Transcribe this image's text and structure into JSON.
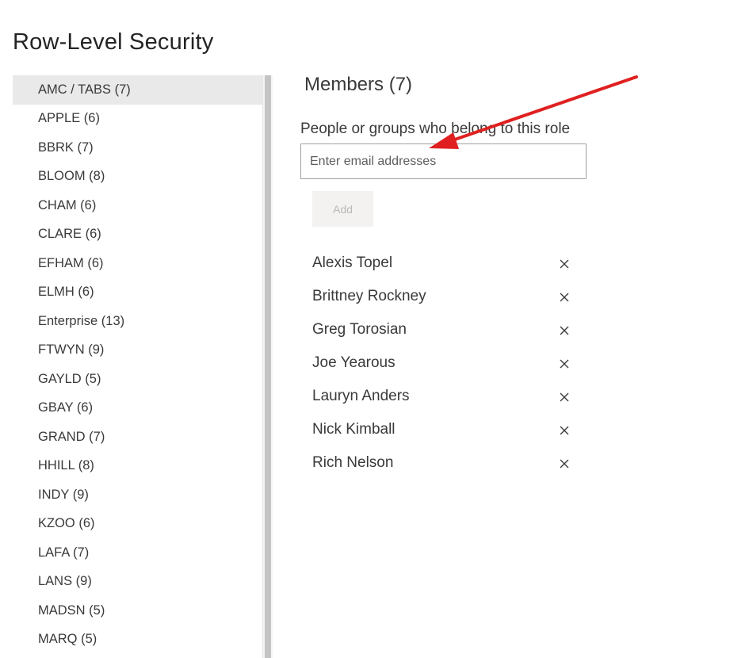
{
  "page": {
    "title": "Row-Level Security"
  },
  "roles": [
    {
      "label": "AMC / TABS (7)",
      "selected": true
    },
    {
      "label": "APPLE (6)"
    },
    {
      "label": "BBRK (7)"
    },
    {
      "label": "BLOOM (8)"
    },
    {
      "label": "CHAM (6)"
    },
    {
      "label": "CLARE (6)"
    },
    {
      "label": "EFHAM (6)"
    },
    {
      "label": "ELMH (6)"
    },
    {
      "label": "Enterprise (13)"
    },
    {
      "label": "FTWYN (9)"
    },
    {
      "label": "GAYLD (5)"
    },
    {
      "label": "GBAY (6)"
    },
    {
      "label": "GRAND (7)"
    },
    {
      "label": "HHILL (8)"
    },
    {
      "label": "INDY (9)"
    },
    {
      "label": "KZOO (6)"
    },
    {
      "label": "LAFA (7)"
    },
    {
      "label": "LANS (9)"
    },
    {
      "label": "MADSN (5)"
    },
    {
      "label": "MARQ (5)"
    }
  ],
  "members_panel": {
    "heading": "Members (7)",
    "field_label": "People or groups who belong to this role",
    "email_input": {
      "value": "",
      "placeholder": "Enter email addresses"
    },
    "add_button_label": "Add",
    "members": [
      {
        "name": "Alexis Topel"
      },
      {
        "name": "Brittney Rockney"
      },
      {
        "name": "Greg Torosian"
      },
      {
        "name": "Joe Yearous"
      },
      {
        "name": "Lauryn Anders"
      },
      {
        "name": "Nick Kimball"
      },
      {
        "name": "Rich Nelson"
      }
    ],
    "remove_icon": "close-icon"
  },
  "annotation": {
    "shape": "arrow",
    "color": "#e02020"
  },
  "colors": {
    "selected_row_bg": "#e9e9e9",
    "text": "#3b3a39",
    "disabled_button_bg": "#f3f2f1",
    "disabled_button_text": "#b9b8b7"
  }
}
